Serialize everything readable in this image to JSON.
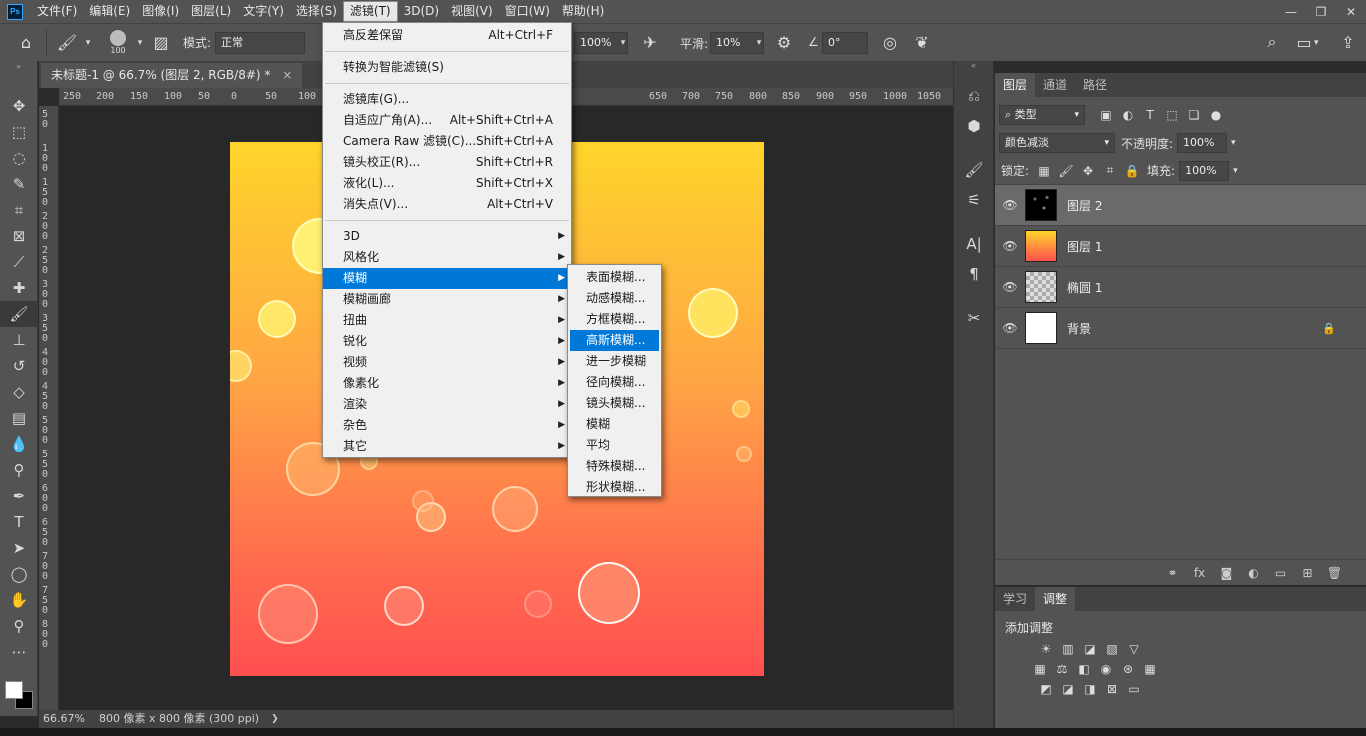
{
  "menubar": {
    "logo": "Ps",
    "items": [
      "文件(F)",
      "编辑(E)",
      "图像(I)",
      "图层(L)",
      "文字(Y)",
      "选择(S)",
      "滤镜(T)",
      "3D(D)",
      "视图(V)",
      "窗口(W)",
      "帮助(H)"
    ],
    "active_index": 6,
    "window_controls": [
      "—",
      "❐",
      "✕"
    ]
  },
  "options": {
    "brush_size": "100",
    "mode_label": "模式:",
    "mode_value": "正常",
    "flow_value": "100%",
    "smooth_label": "平滑:",
    "smooth_value": "10%",
    "angle_value": "0°"
  },
  "document": {
    "tab_title": "未标题-1 @ 66.7% (图层 2, RGB/8#) *",
    "tab_close": "×",
    "ruler_top": [
      "250",
      "200",
      "150",
      "100",
      "50",
      "0",
      "50",
      "100",
      "650",
      "700",
      "750",
      "800",
      "850",
      "900",
      "950",
      "1000",
      "1050"
    ],
    "ruler_left": [
      "5\n0",
      "1\n0\n0",
      "1\n5\n0",
      "2\n0\n0",
      "2\n5\n0",
      "3\n0\n0",
      "3\n5\n0",
      "4\n0\n0",
      "4\n5\n0",
      "5\n0\n0",
      "5\n5\n0",
      "6\n0\n0",
      "6\n5\n0",
      "7\n0\n0",
      "7\n5\n0",
      "8\n0\n0"
    ]
  },
  "statusbar": {
    "zoom": "66.67%",
    "doc_info": "800 像素 x 800 像素 (300 ppi)",
    "arrow": "❯"
  },
  "filter_menu": {
    "top_items": [
      {
        "label": "高反差保留",
        "shortcut": "Alt+Ctrl+F"
      }
    ],
    "convert_item": {
      "label": "转换为智能滤镜(S)"
    },
    "gallery_items": [
      {
        "label": "滤镜库(G)...",
        "shortcut": ""
      },
      {
        "label": "自适应广角(A)...",
        "shortcut": "Alt+Shift+Ctrl+A"
      },
      {
        "label": "Camera Raw 滤镜(C)...",
        "shortcut": "Shift+Ctrl+A"
      },
      {
        "label": "镜头校正(R)...",
        "shortcut": "Shift+Ctrl+R"
      },
      {
        "label": "液化(L)...",
        "shortcut": "Shift+Ctrl+X"
      },
      {
        "label": "消失点(V)...",
        "shortcut": "Alt+Ctrl+V"
      }
    ],
    "submenu_items": [
      {
        "label": "3D"
      },
      {
        "label": "风格化"
      },
      {
        "label": "模糊"
      },
      {
        "label": "模糊画廊"
      },
      {
        "label": "扭曲"
      },
      {
        "label": "锐化"
      },
      {
        "label": "视频"
      },
      {
        "label": "像素化"
      },
      {
        "label": "渲染"
      },
      {
        "label": "杂色"
      },
      {
        "label": "其它"
      }
    ],
    "highlighted": "模糊"
  },
  "blur_menu": {
    "items": [
      "表面模糊...",
      "动感模糊...",
      "方框模糊...",
      "高斯模糊...",
      "进一步模糊",
      "径向模糊...",
      "镜头模糊...",
      "模糊",
      "平均",
      "特殊模糊...",
      "形状模糊..."
    ],
    "highlighted": "高斯模糊..."
  },
  "layers_panel": {
    "tabs": [
      "图层",
      "通道",
      "路径"
    ],
    "filter_kind": "类型",
    "blend_mode": "颜色减淡",
    "opacity_label": "不透明度:",
    "opacity_value": "100%",
    "lock_label": "锁定:",
    "fill_label": "填充:",
    "fill_value": "100%",
    "layers": [
      {
        "name": "图层 2",
        "selected": true,
        "locked": false
      },
      {
        "name": "图层 1",
        "selected": false,
        "locked": false
      },
      {
        "name": "椭圆 1",
        "selected": false,
        "locked": false
      },
      {
        "name": "背景",
        "selected": false,
        "locked": true
      }
    ]
  },
  "adjust_panel": {
    "tabs": [
      "学习",
      "调整"
    ],
    "title": "添加调整"
  },
  "colors": {
    "menu_highlight": "#0078d7",
    "canvas_top": "#ffd52b",
    "canvas_bottom": "#ff5050"
  }
}
